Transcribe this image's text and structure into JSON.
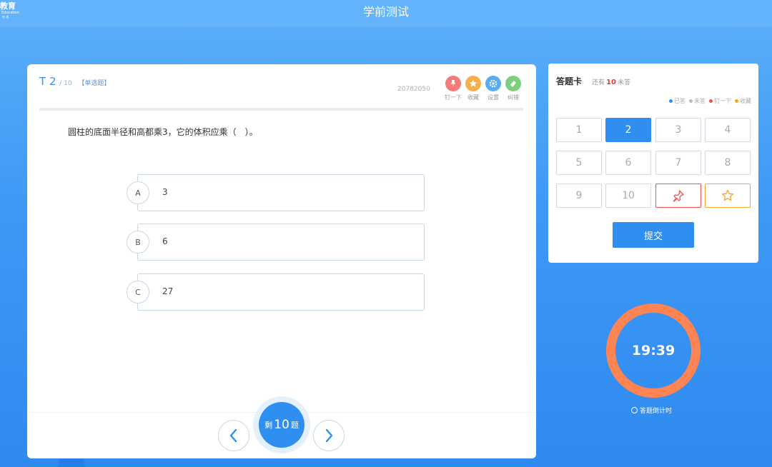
{
  "header": {
    "logo_main": "教育",
    "logo_sub": "Education",
    "logo_small": "在 线",
    "title": "学前测试"
  },
  "question": {
    "prefix": "T",
    "number": "2",
    "total": "/ 10",
    "type": "【单选题】",
    "id": "20782050",
    "stem": "圆柱的底面半径和高都乘3，它的体积应乘（　）。",
    "options": [
      {
        "letter": "A",
        "text": "3"
      },
      {
        "letter": "B",
        "text": "6"
      },
      {
        "letter": "C",
        "text": "27"
      }
    ]
  },
  "tools": [
    {
      "label": "钉一下",
      "icon": "pin-icon",
      "color": "#f47b7b"
    },
    {
      "label": "收藏",
      "icon": "star-icon",
      "color": "#f5b04a"
    },
    {
      "label": "设置",
      "icon": "gear-icon",
      "color": "#5aacf0"
    },
    {
      "label": "纠错",
      "icon": "eraser-icon",
      "color": "#7dcf7d"
    }
  ],
  "navigation": {
    "remaining_prefix": "剩",
    "remaining_count": "10",
    "remaining_suffix": "题"
  },
  "answer_card": {
    "title": "答题卡",
    "remaining_prefix": "还有",
    "remaining_count": "10",
    "remaining_suffix": "未答",
    "legend": [
      {
        "label": "已答",
        "color": "#2e8ff0"
      },
      {
        "label": "未答",
        "color": "#bbbbbb"
      },
      {
        "label": "钉一下",
        "color": "#ef5350"
      },
      {
        "label": "收藏",
        "color": "#f5a623"
      }
    ],
    "cells": [
      "1",
      "2",
      "3",
      "4",
      "5",
      "6",
      "7",
      "8",
      "9",
      "10"
    ],
    "current": "2",
    "submit_label": "提交"
  },
  "timer": {
    "time": "19:39",
    "label": "答题倒计时"
  }
}
